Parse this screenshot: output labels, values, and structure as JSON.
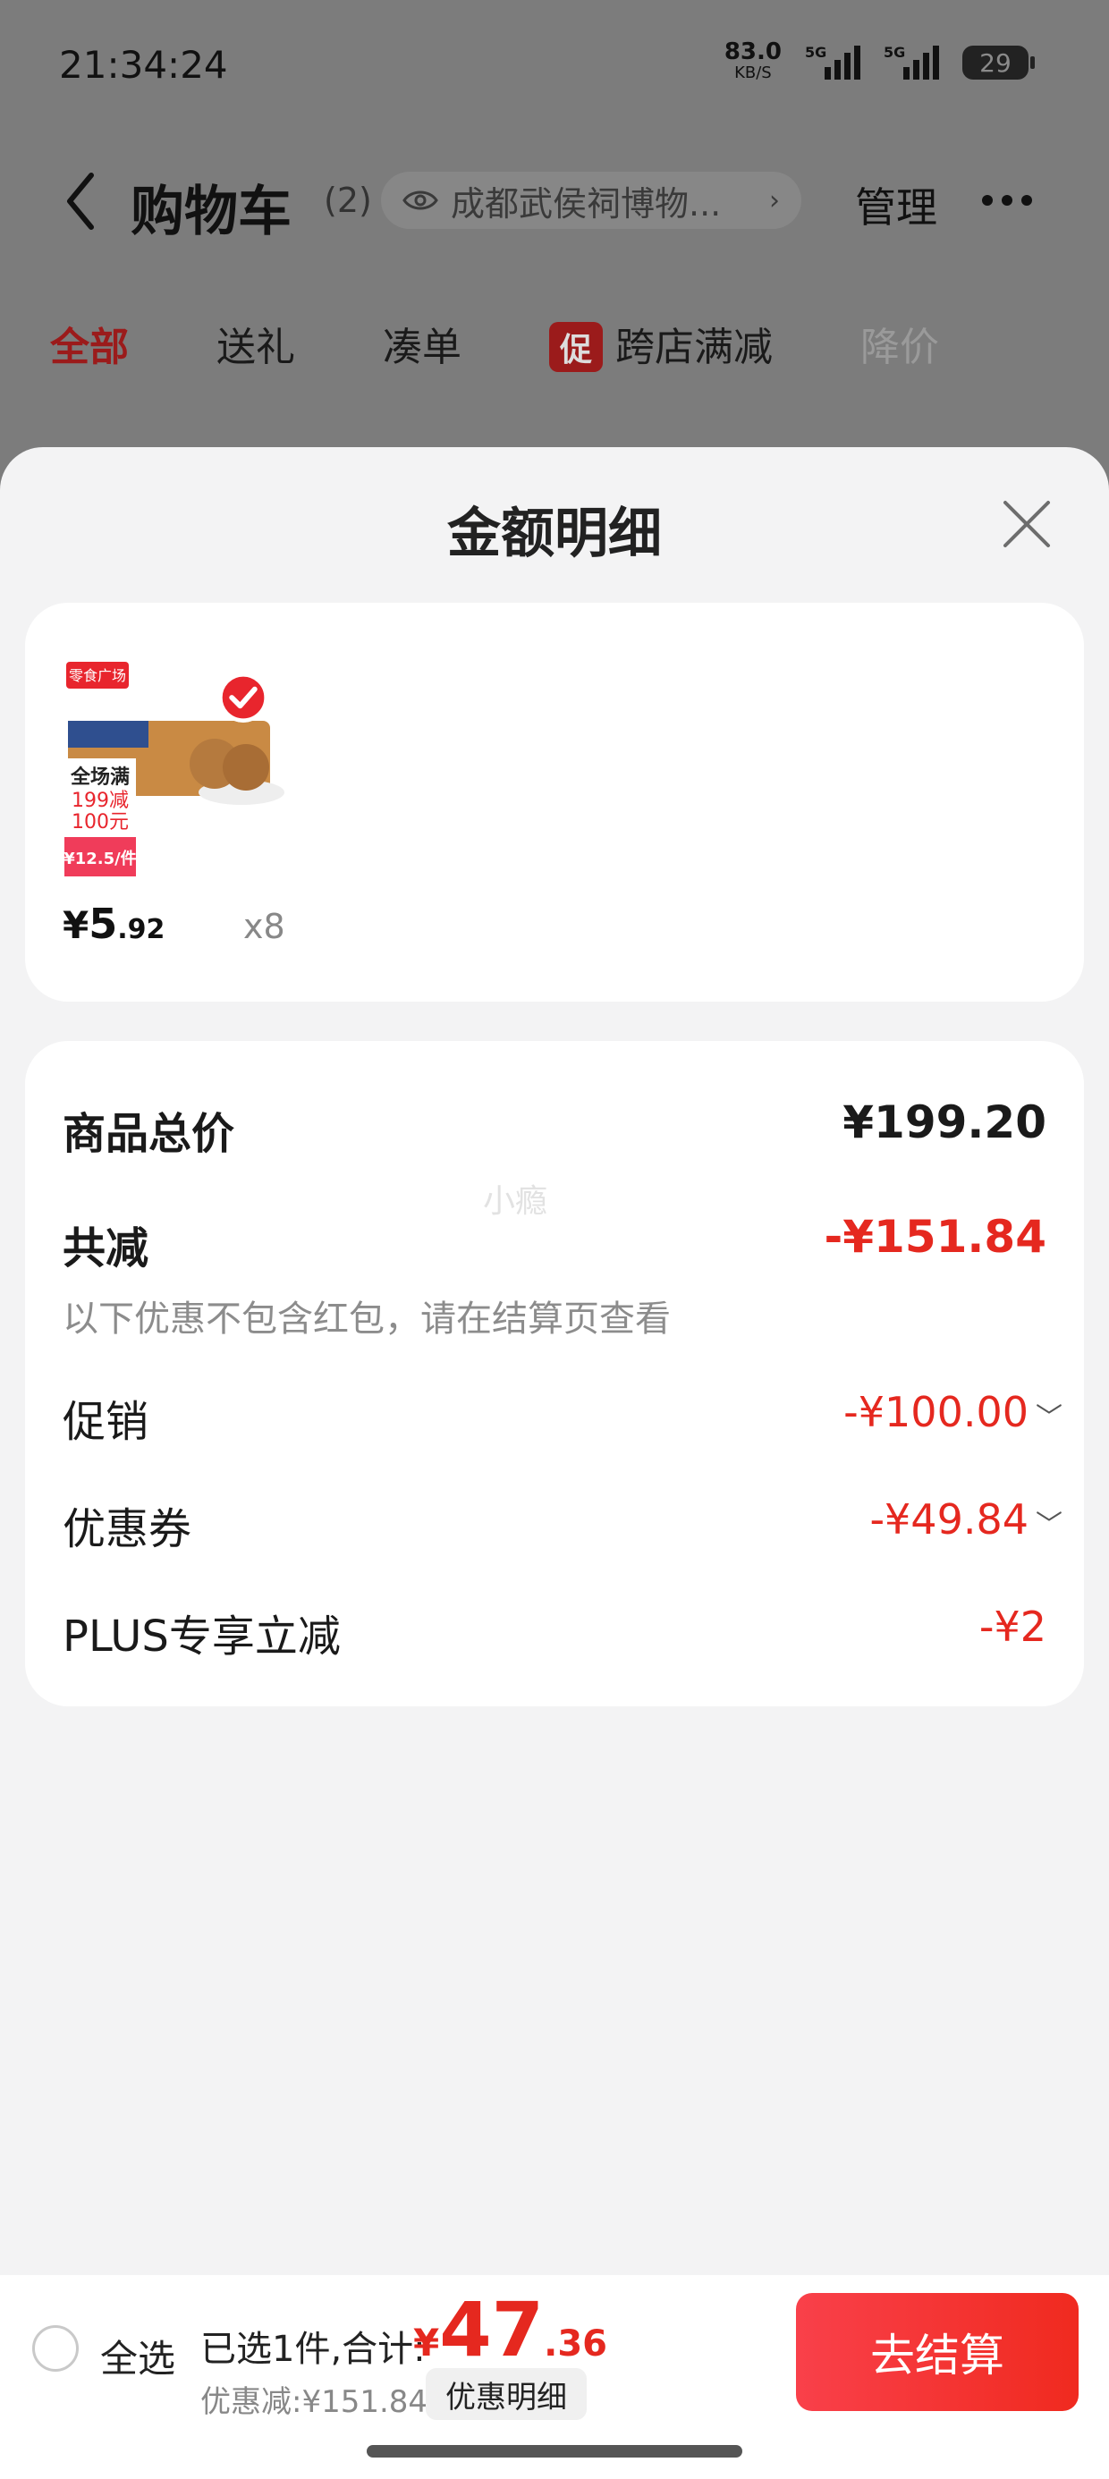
{
  "status_bar": {
    "time": "21:34:24",
    "net_speed": "83.0",
    "net_unit": "KB/S",
    "signal1_label": "5G",
    "signal2_label": "5G",
    "battery": "29"
  },
  "header": {
    "title": "购物车",
    "count": "(2)",
    "location": "成都武侯祠博物...",
    "manage": "管理"
  },
  "filter_tabs": [
    {
      "label": "全部",
      "active": true
    },
    {
      "label": "送礼"
    },
    {
      "label": "凑单"
    },
    {
      "label": "跨店满减",
      "badge": "促"
    },
    {
      "label": "降价"
    }
  ],
  "sheet": {
    "title": "金额明细",
    "product": {
      "price_symbol": "¥",
      "price_int": "5",
      "price_dec": ".92",
      "quantity": "x8",
      "thumb_brand": "零食广场",
      "thumb_promo_line1": "全场满",
      "thumb_promo_line2": "199减",
      "thumb_promo_line3": "100元",
      "thumb_price": "¥12.5/件"
    },
    "summary": {
      "total_label": "商品总价",
      "total_value": "¥199.20",
      "reduce_label": "共减",
      "reduce_value": "-¥151.84",
      "note": "以下优惠不包含红包，请在结算页查看",
      "watermark": "小瘾",
      "items": [
        {
          "label": "促销",
          "value": "-¥100.00",
          "expandable": true
        },
        {
          "label": "优惠券",
          "value": "-¥49.84",
          "expandable": true
        },
        {
          "label": "PLUS专享立减",
          "value": "-¥2",
          "expandable": false
        }
      ]
    }
  },
  "bottom_bar": {
    "select_all": "全选",
    "selected_text": "已选1件,合计:",
    "total_symbol": "¥",
    "total_int": "47",
    "total_dec": ".36",
    "discount_text": "优惠减:¥151.84",
    "detail_chip": "优惠明细",
    "checkout": "去结算"
  },
  "colors": {
    "accent_red": "#e5281f",
    "overlay_gray": "#7c7c7c",
    "sheet_bg": "#f3f3f4"
  }
}
